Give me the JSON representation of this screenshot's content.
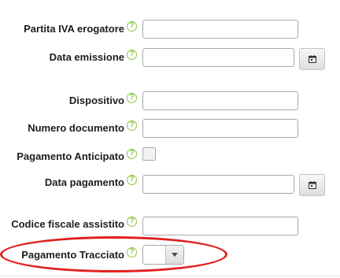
{
  "form": {
    "fields": [
      {
        "id": "partita-iva",
        "label": "Partita IVA erogatore",
        "type": "text",
        "value": ""
      },
      {
        "id": "data-emissione",
        "label": "Data emissione",
        "type": "date",
        "value": ""
      },
      {
        "id": "dispositivo",
        "label": "Dispositivo",
        "type": "text",
        "value": ""
      },
      {
        "id": "numero-documento",
        "label": "Numero documento",
        "type": "text",
        "value": ""
      },
      {
        "id": "pagamento-anticipato",
        "label": "Pagamento Anticipato",
        "type": "checkbox",
        "checked": false
      },
      {
        "id": "data-pagamento",
        "label": "Data pagamento",
        "type": "date",
        "value": ""
      },
      {
        "id": "codice-fiscale",
        "label": "Codice fiscale assistito",
        "type": "text",
        "value": ""
      },
      {
        "id": "pagamento-tracciato",
        "label": "Pagamento Tracciato",
        "type": "select",
        "value": ""
      }
    ],
    "help_symbol": "?"
  },
  "icons": {
    "help": "help-circle-icon",
    "calendar": "calendar-icon",
    "dropdown": "chevron-down-icon"
  },
  "colors": {
    "help_icon": "#8cc63f",
    "highlight": "#e02020",
    "label_text": "#1e1e1e"
  }
}
